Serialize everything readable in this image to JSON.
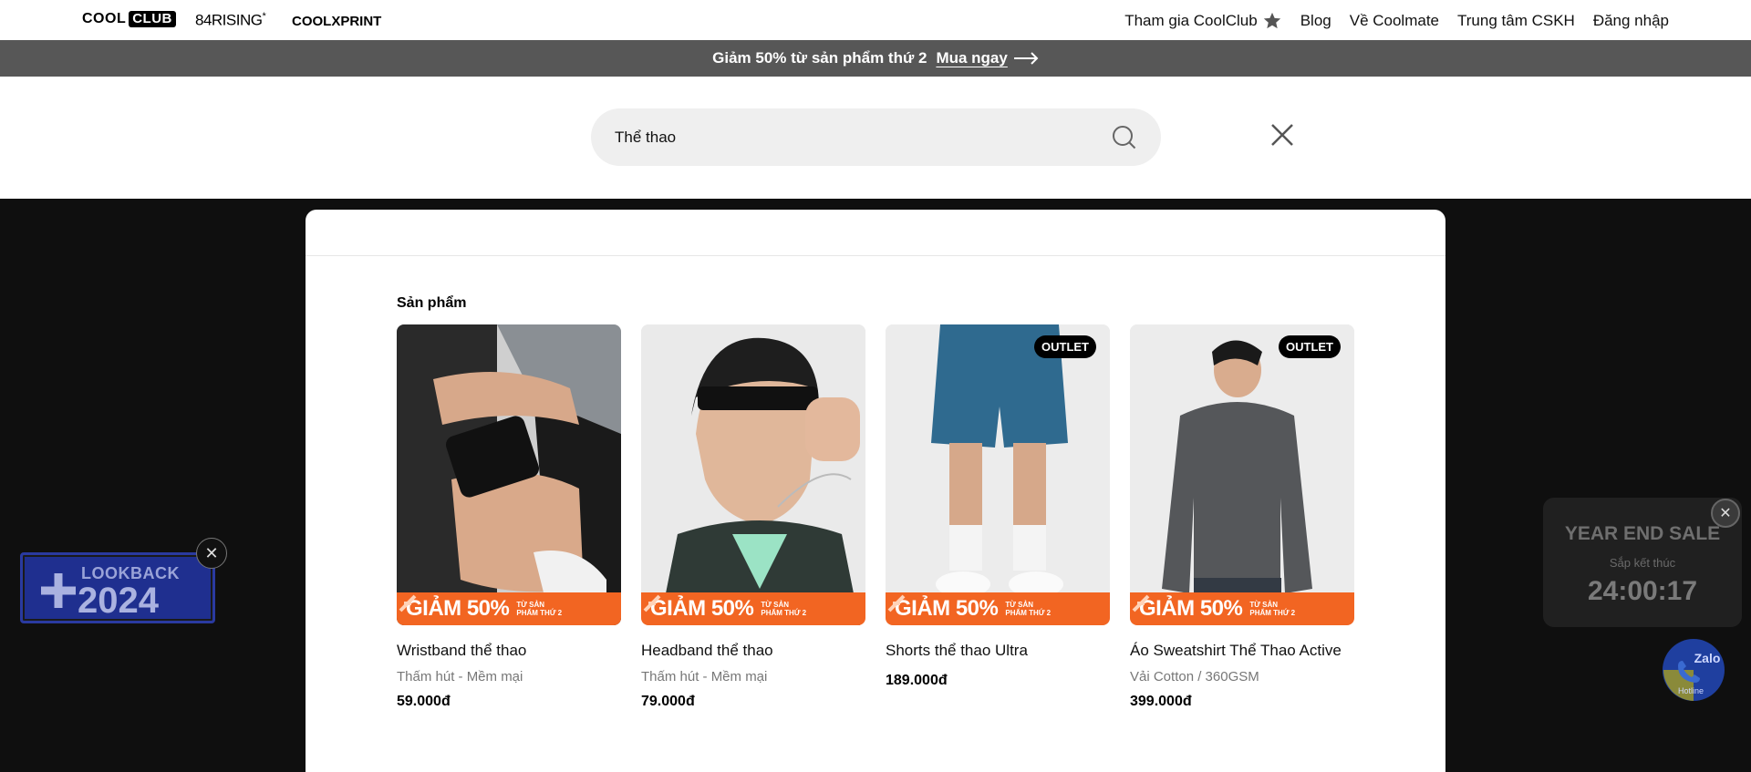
{
  "header": {
    "brands": [
      {
        "label_a": "COOL",
        "label_b": "CLUB"
      },
      {
        "label": "84RISING",
        "sup": "*"
      },
      {
        "label": "COOLXPRINT"
      }
    ],
    "nav": [
      {
        "label": "Tham gia CoolClub",
        "icon": "star-icon"
      },
      {
        "label": "Blog"
      },
      {
        "label": "Về Coolmate"
      },
      {
        "label": "Trung tâm CSKH"
      },
      {
        "label": "Đăng nhập"
      }
    ]
  },
  "promo": {
    "text": "Giảm 50% từ sản phẩm thứ 2",
    "cta": "Mua ngay"
  },
  "search": {
    "value": "Thể thao",
    "placeholder": ""
  },
  "results": {
    "section_title": "Sản phẩm",
    "sale_label": "GIẢM 50%",
    "sale_sub_1": "TỪ SẢN",
    "sale_sub_2": "PHẨM THỨ 2",
    "products": [
      {
        "name": "Wristband thể thao",
        "desc": "Thấm hút - Mềm mại",
        "price": "59.000đ",
        "badge": ""
      },
      {
        "name": "Headband thể thao",
        "desc": "Thấm hút - Mềm mại",
        "price": "79.000đ",
        "badge": ""
      },
      {
        "name": "Shorts thể thao Ultra",
        "desc": "",
        "price": "189.000đ",
        "badge": "OUTLET"
      },
      {
        "name": "Áo Sweatshirt Thể Thao Active",
        "desc": "Vải Cotton / 360GSM",
        "price": "399.000đ",
        "badge": "OUTLET"
      }
    ]
  },
  "lookback": {
    "line1": "LOOKBACK",
    "line2": "2024"
  },
  "year_end": {
    "title": "YEAR END SALE",
    "subtitle": "Sắp kết thúc",
    "timer": "24:00:17"
  },
  "zalo": {
    "label": "Zalo",
    "hotline": "Hotline"
  },
  "colors": {
    "sale_orange": "#f26522",
    "promo_bar": "#575757",
    "lookback_blue": "#1f2f8f"
  }
}
